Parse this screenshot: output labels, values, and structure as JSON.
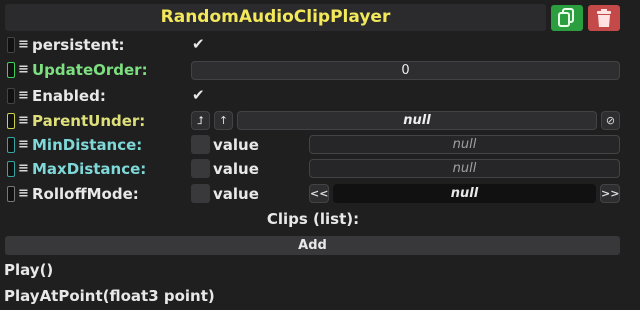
{
  "header": {
    "title": "RandomAudioClipPlayer",
    "copy_icon": "copy-icon",
    "delete_icon": "trash-icon",
    "colors": {
      "title": "#f2e85a",
      "copy": "#2b9f3f",
      "delete": "#c44a4a"
    }
  },
  "properties": [
    {
      "label": "persistent:",
      "checked": true
    },
    {
      "label": "UpdateOrder:",
      "value": "0"
    },
    {
      "label": "Enabled:",
      "checked": true
    },
    {
      "label": "ParentUnder:",
      "value": "null",
      "btn_a": "⮥",
      "btn_b": "↑",
      "clear": "⊘"
    },
    {
      "label": "MinDistance:",
      "toggle_label": "value",
      "value": "null"
    },
    {
      "label": "MaxDistance:",
      "toggle_label": "value",
      "value": "null"
    },
    {
      "label": "RolloffMode:",
      "toggle_label": "value",
      "value": "null",
      "prev": "<<",
      "next": ">>"
    }
  ],
  "clips": {
    "title": "Clips (list):",
    "add_label": "Add"
  },
  "methods": [
    "Play()",
    "PlayAtPoint(float3 point)"
  ]
}
